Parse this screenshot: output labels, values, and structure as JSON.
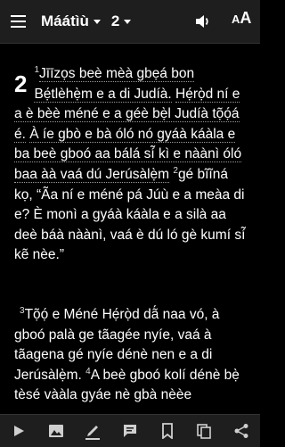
{
  "header": {
    "book": "Máátìù",
    "chapter": "2",
    "text_size_label": "AA",
    "icons": [
      "menu-icon",
      "speaker-icon",
      "text-size-icon"
    ]
  },
  "content": {
    "chapter_number": "2",
    "v1_num": "1",
    "v1_parts": [
      "Jīīzọs beè mèà gbẹá bon ",
      "Bẹ́tlèhẹ̀m e a di Judíà.",
      " ",
      "Hẹ́rọ̀d ní e a è bèè méné e a géè bẹ̀l Judíà tọ̃ọ́á é.",
      " ",
      "À íe gbò e bà óló nó gyáà káàla e ba beè gboó aa bálá sí̃ kì e nàànì óló baa àà vaá dú Jerúsàlẹ̀m"
    ],
    "v2_num": "2",
    "v2_text": "gé bĩĩná kọ, “Ãa ní e méné pá Júù e a meàa di e? È monì a gyáà káàla e a silà aa deè báà nàànì, vaá è dú ló gè kumí sí̃ kẽ nèe.”",
    "v3_num": "3",
    "v3_text": "Tọ̃ọ́ e Méné Hẹ́rọ̀d dã́ naa vó, à gboó palà ge tãagée nyíe, vaá à tãagena gé nyíe dénè nen e a di Jerúsàlẹ̀m.",
    "v4_num": "4",
    "v4_text": "A beè gboó kolí dénè bẹ̀ tèsé vààla gyáe nè gbà nèèe"
  },
  "bottom_icons": [
    "play-icon",
    "image-icon",
    "pen-icon",
    "comment-icon",
    "bookmark-icon",
    "copy-icon",
    "share-icon"
  ]
}
